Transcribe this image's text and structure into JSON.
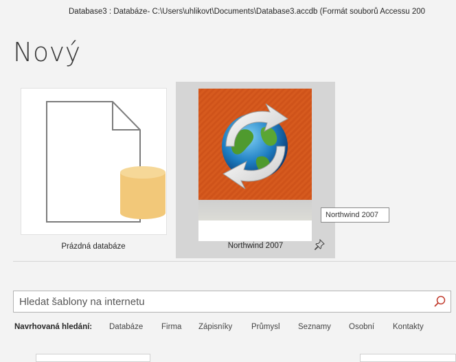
{
  "window": {
    "title": "Database3 : Databáze- C:\\Users\\uhlikovt\\Documents\\Database3.accdb (Formát souborů Accessu 200"
  },
  "page": {
    "title": "Nový"
  },
  "templates": [
    {
      "label": "Prázdná databáze",
      "icon": "blank-database-icon"
    },
    {
      "label": "Northwind 2007",
      "icon": "northwind-globe-icon",
      "selected": true
    }
  ],
  "tooltip": {
    "text": "Northwind 2007"
  },
  "search": {
    "placeholder": "Hledat šablony na internetu",
    "value": "",
    "icon": "search-icon"
  },
  "suggested": {
    "label": "Navrhovaná hledání:",
    "items": [
      "Databáze",
      "Firma",
      "Zápisníky",
      "Průmysl",
      "Seznamy",
      "Osobní",
      "Kontakty"
    ]
  },
  "colors": {
    "accent_orange": "#d65a1e",
    "selected_tile": "#d5d5d5",
    "database_yellow": "#f2c879"
  }
}
